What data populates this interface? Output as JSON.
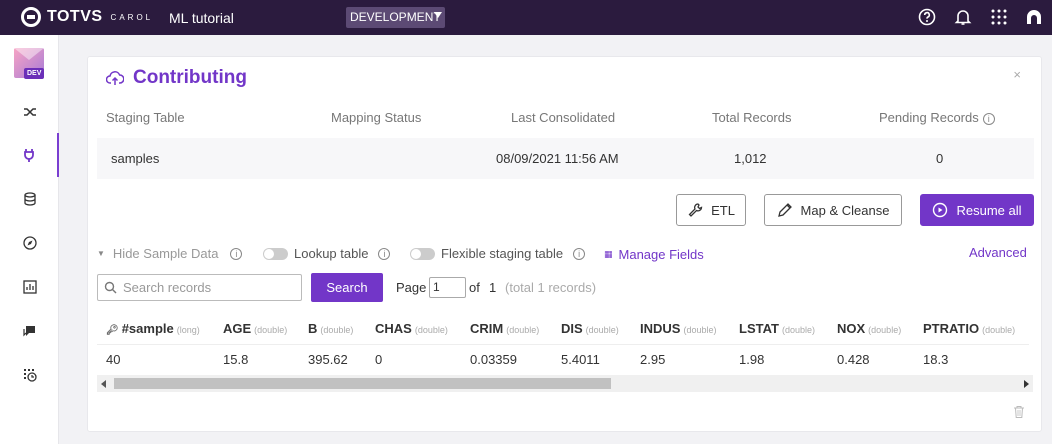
{
  "app": {
    "brand": "TOTVS",
    "brand_sub": "CAROL",
    "title": "ML tutorial",
    "environment": "DEVELOPMENT",
    "accent_color": "#7236c8",
    "topbar_color": "#2b1b3e"
  },
  "topbar_icons": [
    "help-icon",
    "bell-icon",
    "apps-grid-icon",
    "user-icon"
  ],
  "sidebar": {
    "badge": "DEV",
    "items": [
      {
        "icon": "shuffle-icon",
        "active": false
      },
      {
        "icon": "plug-icon",
        "active": true
      },
      {
        "icon": "database-icon",
        "active": false
      },
      {
        "icon": "compass-icon",
        "active": false
      },
      {
        "icon": "chart-icon",
        "active": false
      },
      {
        "icon": "chat-icon",
        "active": false
      },
      {
        "icon": "schedule-icon",
        "active": false
      }
    ]
  },
  "card": {
    "title": "Contributing",
    "close": "×",
    "summary": {
      "headers": [
        "Staging Table",
        "Mapping Status",
        "Last Consolidated",
        "Total Records",
        "Pending Records"
      ],
      "row": {
        "staging_table": "samples",
        "mapping_status": "",
        "last_consolidated": "08/09/2021 11:56 AM",
        "total_records": "1,012",
        "pending_records": "0"
      }
    },
    "buttons": {
      "etl": "ETL",
      "map_cleanse": "Map & Cleanse",
      "resume_all": "Resume all"
    },
    "options": {
      "hide_sample": "Hide Sample Data",
      "lookup_table": "Lookup table",
      "flexible_staging": "Flexible staging table",
      "manage_fields": "Manage Fields",
      "advanced": "Advanced"
    },
    "search": {
      "placeholder": "Search records",
      "button": "Search"
    },
    "pager": {
      "page_label": "Page",
      "page_value": "1",
      "of_label": "of",
      "total_pages": "1",
      "total_records": "(total 1 records)"
    },
    "table": {
      "columns": [
        {
          "name": "#sample",
          "type": "(long)"
        },
        {
          "name": "AGE",
          "type": "(double)"
        },
        {
          "name": "B",
          "type": "(double)"
        },
        {
          "name": "CHAS",
          "type": "(double)"
        },
        {
          "name": "CRIM",
          "type": "(double)"
        },
        {
          "name": "DIS",
          "type": "(double)"
        },
        {
          "name": "INDUS",
          "type": "(double)"
        },
        {
          "name": "LSTAT",
          "type": "(double)"
        },
        {
          "name": "NOX",
          "type": "(double)"
        },
        {
          "name": "PTRATIO",
          "type": "(double)"
        }
      ],
      "rows": [
        [
          "40",
          "15.8",
          "395.62",
          "0",
          "0.03359",
          "5.4011",
          "2.95",
          "1.98",
          "0.428",
          "18.3"
        ]
      ]
    }
  }
}
